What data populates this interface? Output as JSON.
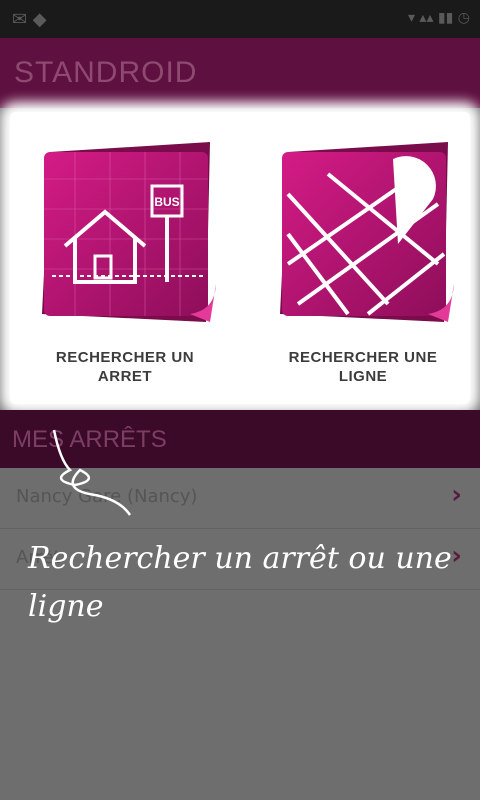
{
  "app": {
    "title": "STANDROID"
  },
  "tiles": [
    {
      "label_line1": "RECHERCHER UN",
      "label_line2": "ARRET",
      "sign": "BUS",
      "icon": "bus-stop-icon"
    },
    {
      "label_line1": "RECHERCHER UNE",
      "label_line2": "LIGNE",
      "icon": "map-pin-icon"
    }
  ],
  "section": {
    "title": "MES ARRÊTS"
  },
  "list": [
    {
      "label": "Nancy Gare (Nancy)"
    },
    {
      "label": "Arrêt"
    }
  ],
  "hint": {
    "text": "Rechercher un arrêt ou une ligne"
  },
  "colors": {
    "accent": "#c2197a",
    "header": "#5e1040"
  }
}
